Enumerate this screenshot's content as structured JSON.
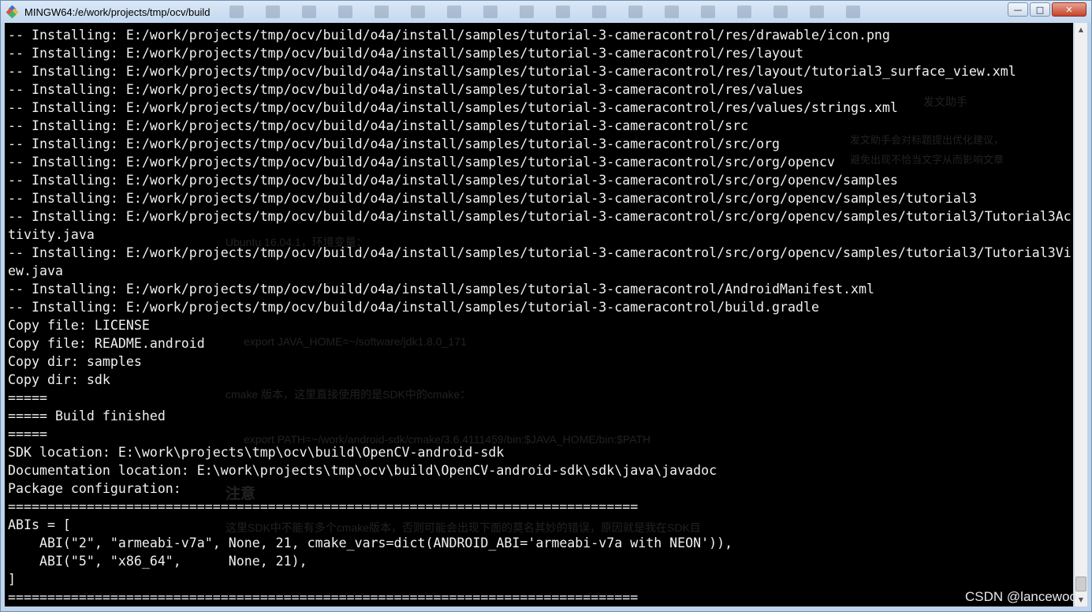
{
  "window": {
    "title": "MINGW64:/e/work/projects/tmp/ocv/build",
    "controls": {
      "minimize": "—",
      "maximize": "□",
      "close": "✕"
    },
    "icon": "mingw-diamond-icon",
    "icon_colors": [
      "#3b6fd8",
      "#e84b3c",
      "#f2b632",
      "#3cb371"
    ]
  },
  "terminal": {
    "foreground": "#f0f0f0",
    "background": "#000000",
    "lines": [
      "-- Installing: E:/work/projects/tmp/ocv/build/o4a/install/samples/tutorial-3-cameracontrol/res/drawable/icon.png",
      "-- Installing: E:/work/projects/tmp/ocv/build/o4a/install/samples/tutorial-3-cameracontrol/res/layout",
      "-- Installing: E:/work/projects/tmp/ocv/build/o4a/install/samples/tutorial-3-cameracontrol/res/layout/tutorial3_surface_view.xml",
      "-- Installing: E:/work/projects/tmp/ocv/build/o4a/install/samples/tutorial-3-cameracontrol/res/values",
      "-- Installing: E:/work/projects/tmp/ocv/build/o4a/install/samples/tutorial-3-cameracontrol/res/values/strings.xml",
      "-- Installing: E:/work/projects/tmp/ocv/build/o4a/install/samples/tutorial-3-cameracontrol/src",
      "-- Installing: E:/work/projects/tmp/ocv/build/o4a/install/samples/tutorial-3-cameracontrol/src/org",
      "-- Installing: E:/work/projects/tmp/ocv/build/o4a/install/samples/tutorial-3-cameracontrol/src/org/opencv",
      "-- Installing: E:/work/projects/tmp/ocv/build/o4a/install/samples/tutorial-3-cameracontrol/src/org/opencv/samples",
      "-- Installing: E:/work/projects/tmp/ocv/build/o4a/install/samples/tutorial-3-cameracontrol/src/org/opencv/samples/tutorial3",
      "-- Installing: E:/work/projects/tmp/ocv/build/o4a/install/samples/tutorial-3-cameracontrol/src/org/opencv/samples/tutorial3/Tutorial3Ac",
      "tivity.java",
      "-- Installing: E:/work/projects/tmp/ocv/build/o4a/install/samples/tutorial-3-cameracontrol/src/org/opencv/samples/tutorial3/Tutorial3Vi",
      "ew.java",
      "-- Installing: E:/work/projects/tmp/ocv/build/o4a/install/samples/tutorial-3-cameracontrol/AndroidManifest.xml",
      "-- Installing: E:/work/projects/tmp/ocv/build/o4a/install/samples/tutorial-3-cameracontrol/build.gradle",
      "Copy file: LICENSE",
      "Copy file: README.android",
      "Copy dir: samples",
      "Copy dir: sdk",
      "=====",
      "===== Build finished",
      "=====",
      "SDK location: E:\\work\\projects\\tmp\\ocv\\build\\OpenCV-android-sdk",
      "Documentation location: E:\\work\\projects\\tmp\\ocv\\build\\OpenCV-android-sdk\\sdk\\java\\javadoc",
      "Package configuration:",
      "================================================================================",
      "ABIs = [",
      "    ABI(\"2\", \"armeabi-v7a\", None, 21, cmake_vars=dict(ANDROID_ABI='armeabi-v7a with NEON')),",
      "    ABI(\"5\", \"x86_64\",      None, 21),",
      "]",
      "================================================================================"
    ]
  },
  "background_ghost": {
    "panel_title": "发文助手",
    "panel_line1": "发文助手会对标题提出优化建议，",
    "panel_line2": "避免出现不恰当文字从而影响文章",
    "env_line": "Ubuntu 16.04.1，环境变量：",
    "java_home": "export JAVA_HOME=~/software/jdk1.8.0_171",
    "cmake_note": "cmake 版本，这里直接使用的是SDK中的cmake：",
    "path_line": "export PATH=~/work/android-sdk/cmake/3.6.4111459/bin:$JAVA_HOME/bin:$PATH",
    "heading": "注意",
    "note_line": "这里SDK中不能有多个cmake版本，否则可能会出现下面的莫名其妙的错误，原因就是我在SDK目"
  },
  "watermark": "CSDN @lancewoo"
}
